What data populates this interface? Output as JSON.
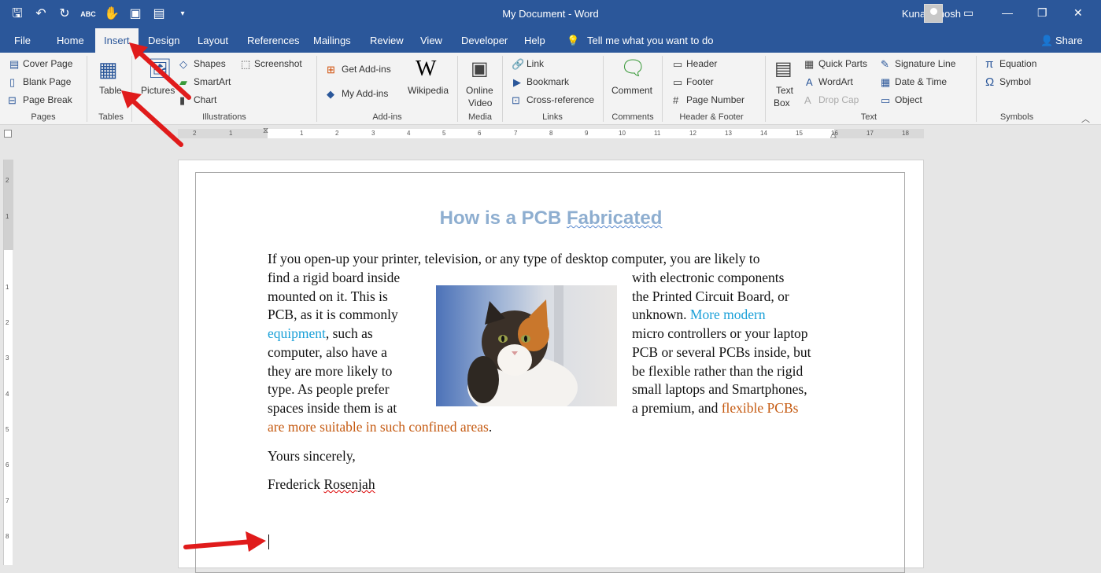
{
  "window": {
    "title": "My Document - Word",
    "user": "Kunal Ghosh"
  },
  "tabs": [
    "File",
    "Home",
    "Insert",
    "Design",
    "Layout",
    "References",
    "Mailings",
    "Review",
    "View",
    "Developer",
    "Help"
  ],
  "tell_me": "Tell me what you want to do",
  "share": "Share",
  "ribbon": {
    "pages": {
      "cover_page": "Cover Page",
      "blank_page": "Blank Page",
      "page_break": "Page Break",
      "group": "Pages"
    },
    "tables": {
      "table": "Table",
      "group": "Tables"
    },
    "illustrations": {
      "pictures": "Pictures",
      "shapes": "Shapes",
      "smartart": "SmartArt",
      "chart": "Chart",
      "screenshot": "Screenshot",
      "group": "Illustrations"
    },
    "addins": {
      "get_addins": "Get Add-ins",
      "my_addins": "My Add-ins",
      "wikipedia": "Wikipedia",
      "group": "Add-ins"
    },
    "media": {
      "online_video_1": "Online",
      "online_video_2": "Video",
      "group": "Media"
    },
    "links": {
      "link": "Link",
      "bookmark": "Bookmark",
      "cross_reference": "Cross-reference",
      "group": "Links"
    },
    "comments": {
      "comment": "Comment",
      "group": "Comments"
    },
    "header_footer": {
      "header": "Header",
      "footer": "Footer",
      "page_number": "Page Number",
      "group": "Header & Footer"
    },
    "text": {
      "text_box_1": "Text",
      "text_box_2": "Box",
      "quick_parts": "Quick Parts",
      "wordart": "WordArt",
      "drop_cap": "Drop Cap",
      "signature_line": "Signature Line",
      "date_time": "Date & Time",
      "object": "Object",
      "group": "Text"
    },
    "symbols": {
      "equation": "Equation",
      "symbol": "Symbol",
      "group": "Symbols"
    }
  },
  "ruler_ticks": [
    "2",
    "1",
    "1",
    "2",
    "3",
    "4",
    "5",
    "6",
    "7",
    "8",
    "9",
    "10",
    "11",
    "12",
    "13",
    "14",
    "15",
    "16",
    "17",
    "18"
  ],
  "vruler_ticks": [
    "2",
    "1",
    "1",
    "2",
    "3",
    "4",
    "5",
    "6",
    "7",
    "8"
  ],
  "document": {
    "title_a": "How is a PCB ",
    "title_b": "Fabricated",
    "line_full": "If you open-up your printer, television, or any type of desktop computer, you are likely to",
    "left": [
      "find a rigid board inside",
      "mounted on it. This is",
      "PCB, as it is commonly",
      "equipment",
      ", such as",
      "computer, also have a",
      "they are more likely to",
      "type. As people prefer",
      "spaces inside them is at"
    ],
    "right": [
      "with electronic components",
      "the Printed Circuit Board, or",
      "unknown. ",
      "More modern",
      "micro controllers or your laptop",
      "PCB or several PCBs inside, but",
      "be flexible rather than the rigid",
      "small laptops and Smartphones,",
      "a premium, and ",
      "flexible PCBs"
    ],
    "last_line_a": "are more suitable in such confined areas",
    "last_line_b": ".",
    "closing": "Yours sincerely,",
    "signature_a": "Frederick ",
    "signature_b": "Rosenjah"
  }
}
